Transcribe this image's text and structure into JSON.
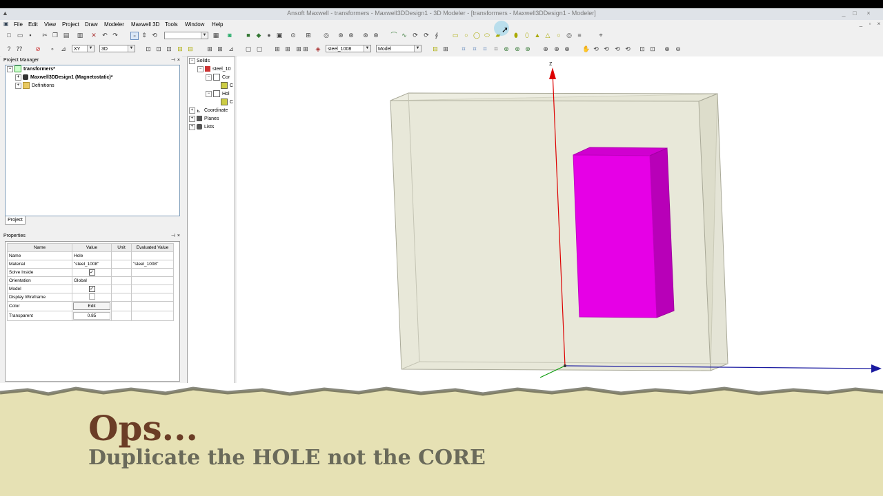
{
  "window": {
    "title": "Ansoft Maxwell - transformers - Maxwell3DDesign1 - 3D Modeler - [transformers - Maxwell3DDesign1 - Modeler]",
    "controls": [
      "_",
      "□",
      "×"
    ]
  },
  "menu": [
    "File",
    "Edit",
    "View",
    "Project",
    "Draw",
    "Modeler",
    "Maxwell 3D",
    "Tools",
    "Window",
    "Help"
  ],
  "toolbar": {
    "plane_combo": "XY",
    "mode_combo": "3D",
    "material_combo": "steel_1008",
    "model_combo": "Model"
  },
  "project_manager": {
    "title": "Project Manager",
    "tab": "Project",
    "tree": [
      {
        "label": "transformers*",
        "level": 0,
        "bold": true
      },
      {
        "label": "Maxwell3DDesign1 (Magnetostatic)*",
        "level": 1,
        "bold": true
      },
      {
        "label": "Definitions",
        "level": 1,
        "bold": false
      }
    ]
  },
  "model_tree": [
    {
      "label": "Solids",
      "level": 0
    },
    {
      "label": "steel_10",
      "level": 1
    },
    {
      "label": "Cor",
      "level": 2
    },
    {
      "label": "C",
      "level": 3
    },
    {
      "label": "Hol",
      "level": 2
    },
    {
      "label": "C",
      "level": 3
    },
    {
      "label": "Coordinate",
      "level": 0
    },
    {
      "label": "Planes",
      "level": 0
    },
    {
      "label": "Lists",
      "level": 0
    }
  ],
  "properties": {
    "title": "Properties",
    "columns": [
      "Name",
      "Value",
      "Unit",
      "Evaluated Value"
    ],
    "rows": [
      {
        "name": "Name",
        "value": "Hole",
        "unit": "",
        "evaluated": ""
      },
      {
        "name": "Material",
        "value": "\"steel_1008\"",
        "unit": "",
        "evaluated": "\"steel_1008\""
      },
      {
        "name": "Solve Inside",
        "value": "",
        "checkbox": true,
        "unit": "",
        "evaluated": ""
      },
      {
        "name": "Orientation",
        "value": "Global",
        "unit": "",
        "evaluated": ""
      },
      {
        "name": "Model",
        "value": "",
        "checkbox": true,
        "unit": "",
        "evaluated": ""
      },
      {
        "name": "Display Wireframe",
        "value": "",
        "checkbox": false,
        "unit": "",
        "evaluated": ""
      },
      {
        "name": "Color",
        "value": "Edit",
        "unit": "",
        "evaluated": ""
      },
      {
        "name": "Transparent",
        "value": "0.85",
        "unit": "",
        "evaluated": ""
      }
    ]
  },
  "viewport": {
    "axis_label": "z",
    "core_color": "#e0e0cc",
    "hole_color": "#e600e6"
  },
  "banner": {
    "line1": "Ops...",
    "line2": "Duplicate the HOLE not the CORE"
  }
}
